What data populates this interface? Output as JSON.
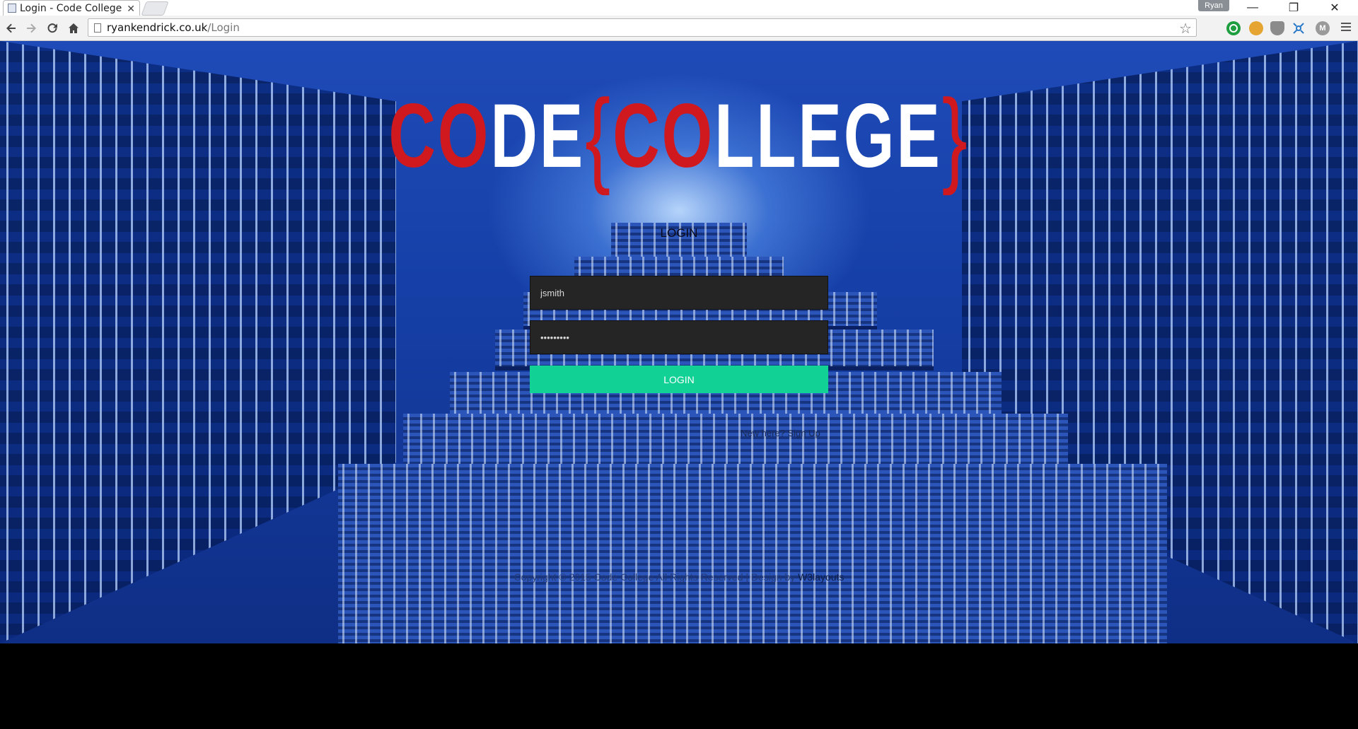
{
  "browser": {
    "tab_title": "Login - Code College",
    "tab_close": "✕",
    "profile_name": "Ryan",
    "window_controls": {
      "minimize": "—",
      "restore": "❐",
      "close": "✕"
    },
    "url_host": "ryankendrick.co.uk",
    "url_path": "/Login",
    "icons": {
      "back": "back-arrow-icon",
      "forward": "forward-arrow-icon",
      "reload": "reload-icon",
      "home": "home-icon",
      "bookmark": "star-icon",
      "menu": "hamburger-menu-icon"
    }
  },
  "page": {
    "logo": {
      "part1_red": "CO",
      "part1_white": "DE",
      "brace_open": "{",
      "part2_red": "CO",
      "part2_white": "LLEGE",
      "brace_close": "}"
    },
    "login_heading": "LOGIN",
    "username_value": "jsmith",
    "password_value": "•••••••••",
    "login_button": "LOGIN",
    "signup_prompt": "New here?",
    "signup_link": "Sign Up",
    "footer": {
      "copyright": "Copyright © 2015 Code College All Rights Reserved | Design by",
      "designer": "W3layouts"
    },
    "colors": {
      "accent_green": "#12d195",
      "logo_red": "#d0191f",
      "input_bg": "#252525"
    }
  }
}
